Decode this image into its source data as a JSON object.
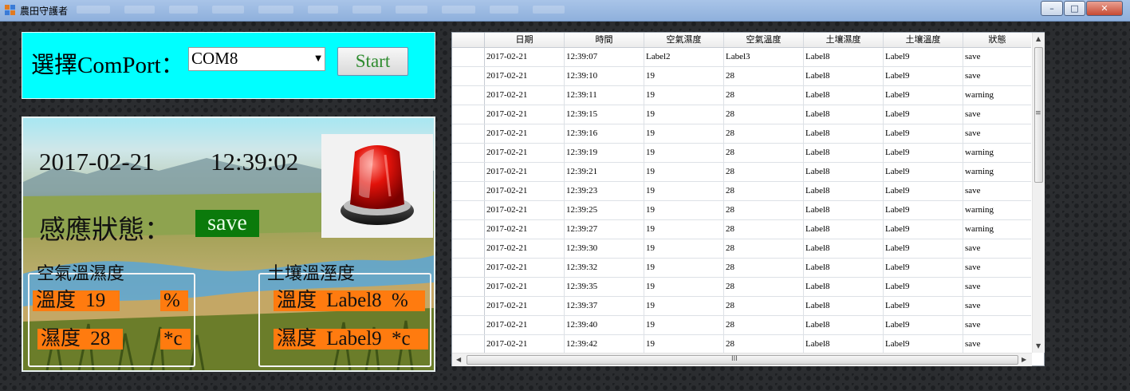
{
  "window": {
    "title": "農田守護者",
    "minimize_glyph": "–",
    "maximize_glyph": "□",
    "close_glyph": "✕"
  },
  "port": {
    "label": "選擇ComPort：",
    "selected": "COM8",
    "start_label": "Start"
  },
  "status": {
    "date": "2017-02-21",
    "time": "12:39:02",
    "state_label": "感應狀態：",
    "state_value": "save",
    "alarm_icon": "red-siren-icon"
  },
  "air": {
    "group_label": "空氣溫濕度",
    "temp_label": "溫度",
    "temp_value": "19",
    "temp_unit": "%",
    "humid_label": "濕度",
    "humid_value": "28",
    "humid_unit": "*c"
  },
  "soil": {
    "group_label": "土壤溫溼度",
    "temp_label": "溫度",
    "temp_value": "Label8",
    "temp_unit": "%",
    "humid_label": "濕度",
    "humid_value": "Label9",
    "humid_unit": "*c"
  },
  "grid": {
    "columns": [
      "日期",
      "時間",
      "空氣濕度",
      "空氣溫度",
      "土壤濕度",
      "土壤溫度",
      "狀態"
    ],
    "rows": [
      [
        "2017-02-21",
        "12:39:07",
        "Label2",
        "Label3",
        "Label8",
        "Label9",
        "save"
      ],
      [
        "2017-02-21",
        "12:39:10",
        "19",
        "28",
        "Label8",
        "Label9",
        "save"
      ],
      [
        "2017-02-21",
        "12:39:11",
        "19",
        "28",
        "Label8",
        "Label9",
        "warning"
      ],
      [
        "2017-02-21",
        "12:39:15",
        "19",
        "28",
        "Label8",
        "Label9",
        "save"
      ],
      [
        "2017-02-21",
        "12:39:16",
        "19",
        "28",
        "Label8",
        "Label9",
        "save"
      ],
      [
        "2017-02-21",
        "12:39:19",
        "19",
        "28",
        "Label8",
        "Label9",
        "warning"
      ],
      [
        "2017-02-21",
        "12:39:21",
        "19",
        "28",
        "Label8",
        "Label9",
        "warning"
      ],
      [
        "2017-02-21",
        "12:39:23",
        "19",
        "28",
        "Label8",
        "Label9",
        "save"
      ],
      [
        "2017-02-21",
        "12:39:25",
        "19",
        "28",
        "Label8",
        "Label9",
        "warning"
      ],
      [
        "2017-02-21",
        "12:39:27",
        "19",
        "28",
        "Label8",
        "Label9",
        "warning"
      ],
      [
        "2017-02-21",
        "12:39:30",
        "19",
        "28",
        "Label8",
        "Label9",
        "save"
      ],
      [
        "2017-02-21",
        "12:39:32",
        "19",
        "28",
        "Label8",
        "Label9",
        "save"
      ],
      [
        "2017-02-21",
        "12:39:35",
        "19",
        "28",
        "Label8",
        "Label9",
        "save"
      ],
      [
        "2017-02-21",
        "12:39:37",
        "19",
        "28",
        "Label8",
        "Label9",
        "save"
      ],
      [
        "2017-02-21",
        "12:39:40",
        "19",
        "28",
        "Label8",
        "Label9",
        "save"
      ],
      [
        "2017-02-21",
        "12:39:42",
        "19",
        "28",
        "Label8",
        "Label9",
        "save"
      ]
    ],
    "hscroll_grip": "III",
    "vscroll_grip": "≡"
  },
  "colors": {
    "port_panel_bg": "#00ffff",
    "state_bg": "#0b7a0b",
    "value_badge_bg": "#ff7b0f",
    "start_text": "#2e8b2e"
  }
}
